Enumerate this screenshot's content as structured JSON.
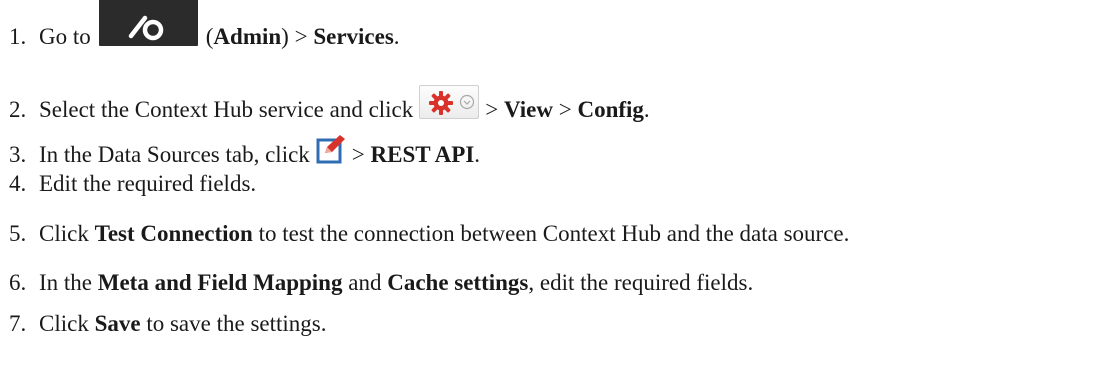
{
  "steps": [
    {
      "number": "1.",
      "lead": "Go to",
      "admin_label": "Admin",
      "sep": ">",
      "services_label": "Services",
      "end": "."
    },
    {
      "number": "2.",
      "lead": "Select the Context Hub service and click",
      "sep1": ">",
      "view_label": "View",
      "sep2": ">",
      "config_label": "Config",
      "end": "."
    },
    {
      "number": "3.",
      "lead": "In the Data Sources tab, click",
      "sep": ">",
      "rest_label": "REST API",
      "end": "."
    },
    {
      "number": "4.",
      "text": "Edit the required fields."
    },
    {
      "number": "5.",
      "lead": "Click",
      "test_label": "Test Connection",
      "tail": "to test the connection between Context Hub and the data source."
    },
    {
      "number": "6.",
      "lead": "In the",
      "meta_label": "Meta and Field Mapping",
      "and_word": "and",
      "cache_label": "Cache settings",
      "tail": ", edit the required fields."
    },
    {
      "number": "7.",
      "lead": "Click",
      "save_label": "Save",
      "tail": "to save the settings."
    }
  ],
  "icons": {
    "admin": "admin-tools-icon",
    "gear": "gear-icon",
    "chevron": "chevron-down-icon",
    "edit": "edit-icon"
  },
  "colors": {
    "admin_button_bg": "#2b2b2b",
    "gear_red": "#d8322a",
    "edit_red": "#d8322a",
    "edit_blue": "#2f6db3"
  }
}
